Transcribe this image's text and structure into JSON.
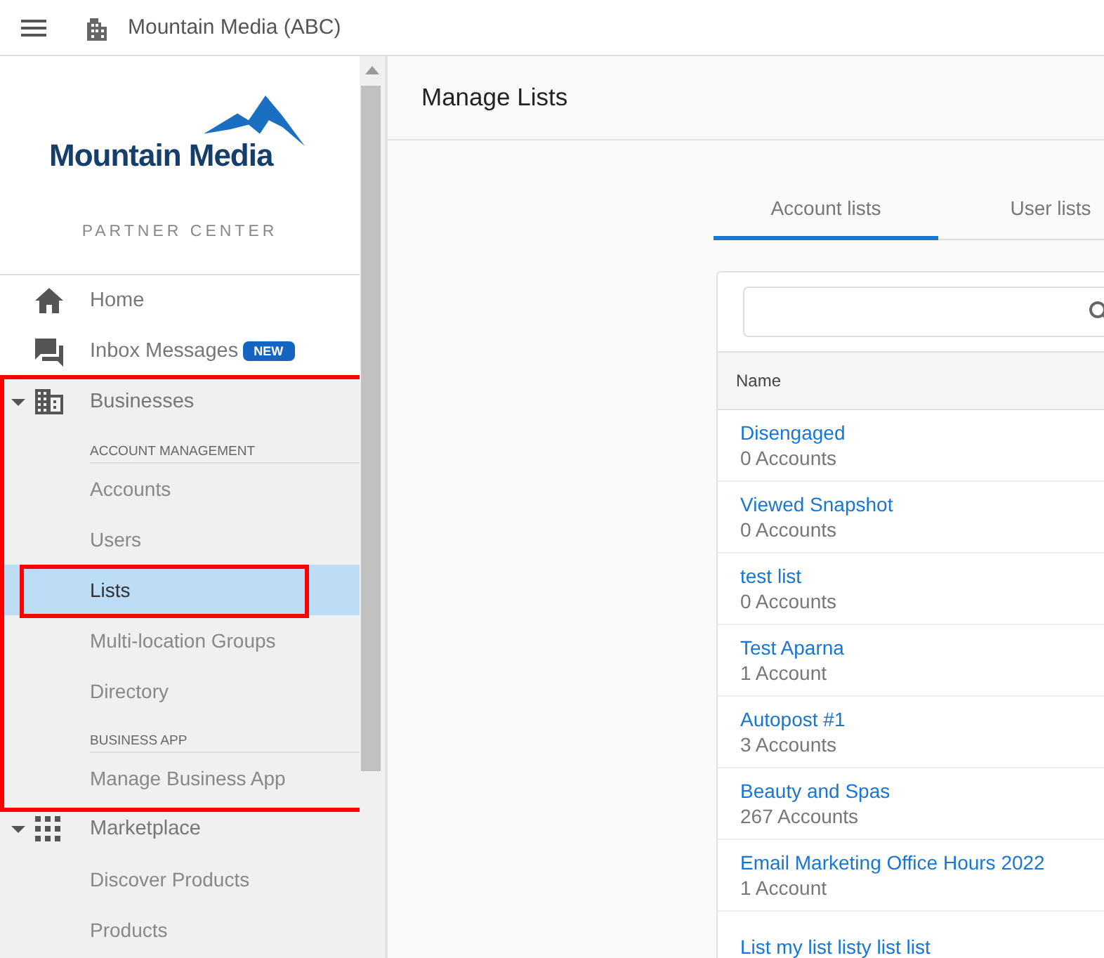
{
  "top_bar": {
    "title": "Mountain Media (ABC)"
  },
  "sidebar": {
    "logo_text": "Mountain Media",
    "subtitle": "PARTNER CENTER",
    "items": [
      {
        "kind": "link",
        "label": "Home"
      },
      {
        "kind": "link",
        "label": "Inbox Messages",
        "badge": "NEW"
      },
      {
        "kind": "group",
        "label": "Businesses",
        "expanded": true,
        "sections": [
          {
            "heading": "ACCOUNT MANAGEMENT",
            "children": [
              {
                "label": "Accounts",
                "selected": false
              },
              {
                "label": "Users",
                "selected": false
              },
              {
                "label": "Lists",
                "selected": true
              },
              {
                "label": "Multi-location Groups",
                "selected": false
              },
              {
                "label": "Directory",
                "selected": false
              }
            ]
          },
          {
            "heading": "BUSINESS APP",
            "children": [
              {
                "label": "Manage Business App",
                "selected": false
              }
            ]
          }
        ]
      },
      {
        "kind": "group",
        "label": "Marketplace",
        "expanded": true,
        "sections": [
          {
            "children": [
              {
                "label": "Discover Products",
                "selected": false
              },
              {
                "label": "Products",
                "selected": false
              }
            ]
          }
        ]
      }
    ]
  },
  "page": {
    "title": "Manage Lists",
    "tabs": [
      {
        "label": "Account lists",
        "selected": true
      },
      {
        "label": "User lists",
        "selected": false
      }
    ],
    "table": {
      "columns": [
        "Name"
      ],
      "rows": [
        {
          "name": "Disengaged",
          "count": "0 Accounts"
        },
        {
          "name": "Viewed Snapshot",
          "count": "0 Accounts"
        },
        {
          "name": "test list",
          "count": "0 Accounts"
        },
        {
          "name": "Test Aparna",
          "count": "1 Account"
        },
        {
          "name": "Autopost #1",
          "count": "3 Accounts"
        },
        {
          "name": "Beauty and Spas",
          "count": "267 Accounts"
        },
        {
          "name": "Email Marketing Office Hours 2022",
          "count": "1 Account"
        },
        {
          "name": "List my list listy list list"
        }
      ]
    }
  }
}
